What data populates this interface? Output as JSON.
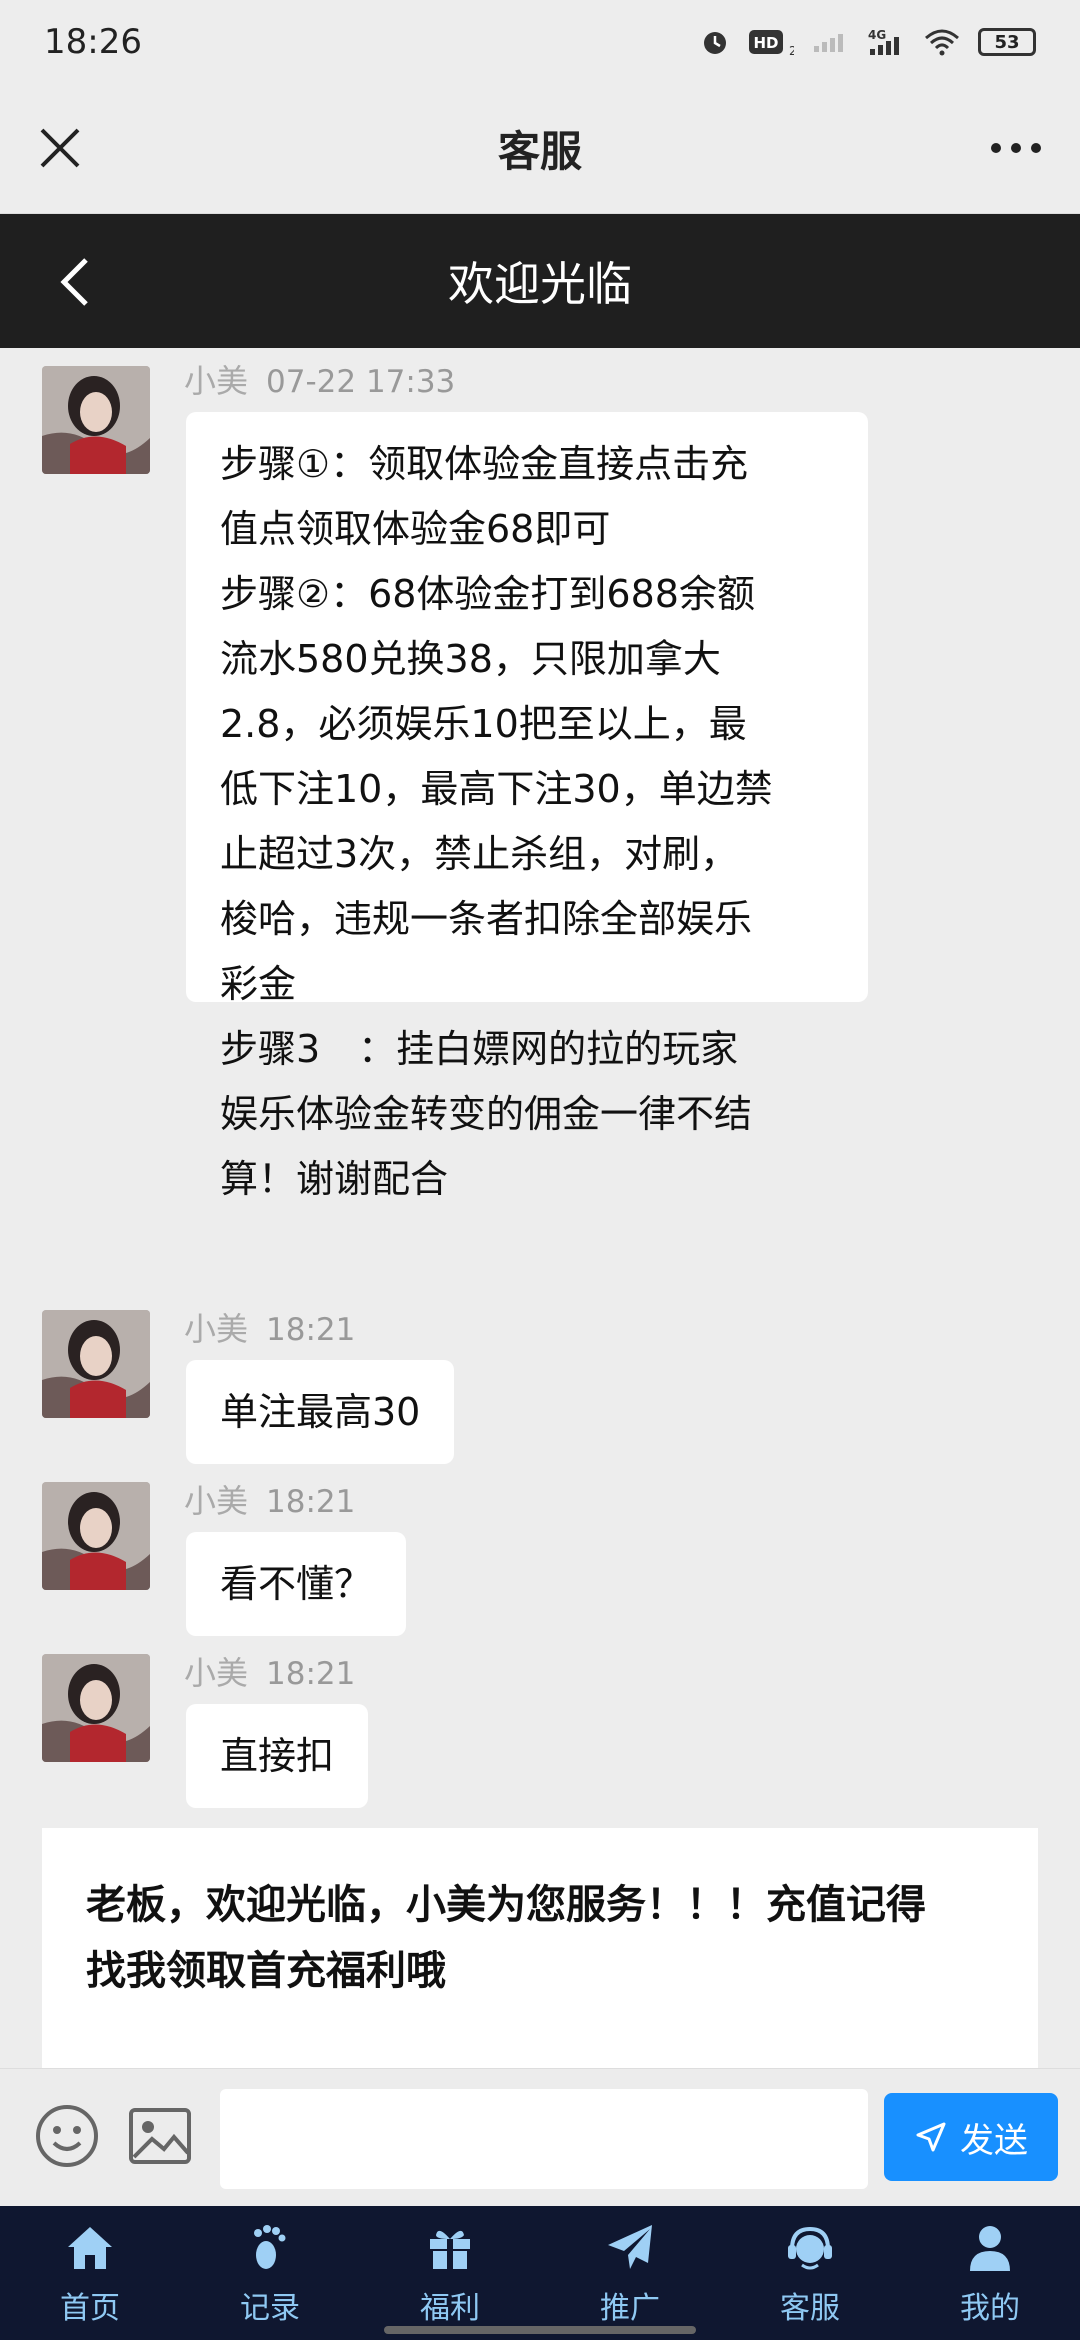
{
  "status_bar": {
    "time": "18:26",
    "battery": "53"
  },
  "wechat_bar": {
    "title": "客服"
  },
  "app_header": {
    "title": "欢迎光临"
  },
  "messages": [
    {
      "sender": "小美",
      "time": "07-22 17:33",
      "lines": [
        "步骤①：领取体验金直接点击充",
        "值点领取体验金68即可",
        "步骤②：68体验金打到688余额",
        "流水580兑换38，只限加拿大",
        "2.8，必须娱乐10把至以上，最",
        "低下注10，最高下注30，单边禁",
        "止超过3次，禁止杀组，对刷，",
        "梭哈，违规一条者扣除全部娱乐",
        "彩金",
        "步骤3　：挂白嫖网的拉的玩家",
        "娱乐体验金转变的佣金一律不结",
        "算！谢谢配合"
      ]
    },
    {
      "sender": "小美",
      "time": "18:21",
      "lines": [
        "单注最高30"
      ]
    },
    {
      "sender": "小美",
      "time": "18:21",
      "lines": [
        "看不懂？"
      ]
    },
    {
      "sender": "小美",
      "time": "18:21",
      "lines": [
        "直接扣"
      ]
    }
  ],
  "announcement": {
    "line1": "老板，欢迎光临，小美为您服务！！！充值记得",
    "line2": "找我领取首充福利哦"
  },
  "input": {
    "placeholder": "",
    "send_label": "发送"
  },
  "tabs": [
    {
      "label": "首页",
      "icon": "home-icon"
    },
    {
      "label": "记录",
      "icon": "footprint-icon"
    },
    {
      "label": "福利",
      "icon": "gift-icon"
    },
    {
      "label": "推广",
      "icon": "paper-plane-icon"
    },
    {
      "label": "客服",
      "icon": "headset-icon"
    },
    {
      "label": "我的",
      "icon": "user-icon"
    }
  ],
  "colors": {
    "send_button": "#1890ff",
    "tabbar_bg": "#0f1730",
    "header_bg": "#1f1f1f"
  }
}
